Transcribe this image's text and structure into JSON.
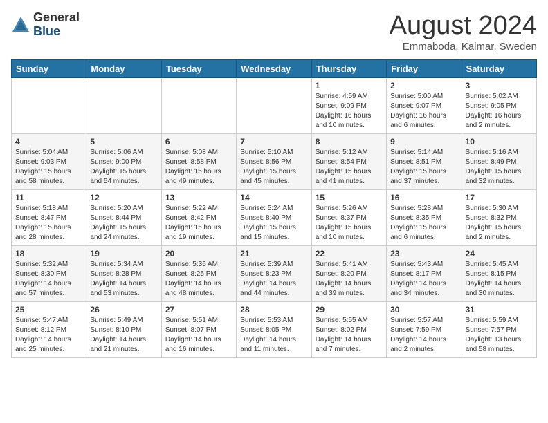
{
  "header": {
    "logo_general": "General",
    "logo_blue": "Blue",
    "month_title": "August 2024",
    "location": "Emmaboda, Kalmar, Sweden"
  },
  "days_of_week": [
    "Sunday",
    "Monday",
    "Tuesday",
    "Wednesday",
    "Thursday",
    "Friday",
    "Saturday"
  ],
  "weeks": [
    [
      {
        "day": "",
        "info": ""
      },
      {
        "day": "",
        "info": ""
      },
      {
        "day": "",
        "info": ""
      },
      {
        "day": "",
        "info": ""
      },
      {
        "day": "1",
        "info": "Sunrise: 4:59 AM\nSunset: 9:09 PM\nDaylight: 16 hours\nand 10 minutes."
      },
      {
        "day": "2",
        "info": "Sunrise: 5:00 AM\nSunset: 9:07 PM\nDaylight: 16 hours\nand 6 minutes."
      },
      {
        "day": "3",
        "info": "Sunrise: 5:02 AM\nSunset: 9:05 PM\nDaylight: 16 hours\nand 2 minutes."
      }
    ],
    [
      {
        "day": "4",
        "info": "Sunrise: 5:04 AM\nSunset: 9:03 PM\nDaylight: 15 hours\nand 58 minutes."
      },
      {
        "day": "5",
        "info": "Sunrise: 5:06 AM\nSunset: 9:00 PM\nDaylight: 15 hours\nand 54 minutes."
      },
      {
        "day": "6",
        "info": "Sunrise: 5:08 AM\nSunset: 8:58 PM\nDaylight: 15 hours\nand 49 minutes."
      },
      {
        "day": "7",
        "info": "Sunrise: 5:10 AM\nSunset: 8:56 PM\nDaylight: 15 hours\nand 45 minutes."
      },
      {
        "day": "8",
        "info": "Sunrise: 5:12 AM\nSunset: 8:54 PM\nDaylight: 15 hours\nand 41 minutes."
      },
      {
        "day": "9",
        "info": "Sunrise: 5:14 AM\nSunset: 8:51 PM\nDaylight: 15 hours\nand 37 minutes."
      },
      {
        "day": "10",
        "info": "Sunrise: 5:16 AM\nSunset: 8:49 PM\nDaylight: 15 hours\nand 32 minutes."
      }
    ],
    [
      {
        "day": "11",
        "info": "Sunrise: 5:18 AM\nSunset: 8:47 PM\nDaylight: 15 hours\nand 28 minutes."
      },
      {
        "day": "12",
        "info": "Sunrise: 5:20 AM\nSunset: 8:44 PM\nDaylight: 15 hours\nand 24 minutes."
      },
      {
        "day": "13",
        "info": "Sunrise: 5:22 AM\nSunset: 8:42 PM\nDaylight: 15 hours\nand 19 minutes."
      },
      {
        "day": "14",
        "info": "Sunrise: 5:24 AM\nSunset: 8:40 PM\nDaylight: 15 hours\nand 15 minutes."
      },
      {
        "day": "15",
        "info": "Sunrise: 5:26 AM\nSunset: 8:37 PM\nDaylight: 15 hours\nand 10 minutes."
      },
      {
        "day": "16",
        "info": "Sunrise: 5:28 AM\nSunset: 8:35 PM\nDaylight: 15 hours\nand 6 minutes."
      },
      {
        "day": "17",
        "info": "Sunrise: 5:30 AM\nSunset: 8:32 PM\nDaylight: 15 hours\nand 2 minutes."
      }
    ],
    [
      {
        "day": "18",
        "info": "Sunrise: 5:32 AM\nSunset: 8:30 PM\nDaylight: 14 hours\nand 57 minutes."
      },
      {
        "day": "19",
        "info": "Sunrise: 5:34 AM\nSunset: 8:28 PM\nDaylight: 14 hours\nand 53 minutes."
      },
      {
        "day": "20",
        "info": "Sunrise: 5:36 AM\nSunset: 8:25 PM\nDaylight: 14 hours\nand 48 minutes."
      },
      {
        "day": "21",
        "info": "Sunrise: 5:39 AM\nSunset: 8:23 PM\nDaylight: 14 hours\nand 44 minutes."
      },
      {
        "day": "22",
        "info": "Sunrise: 5:41 AM\nSunset: 8:20 PM\nDaylight: 14 hours\nand 39 minutes."
      },
      {
        "day": "23",
        "info": "Sunrise: 5:43 AM\nSunset: 8:17 PM\nDaylight: 14 hours\nand 34 minutes."
      },
      {
        "day": "24",
        "info": "Sunrise: 5:45 AM\nSunset: 8:15 PM\nDaylight: 14 hours\nand 30 minutes."
      }
    ],
    [
      {
        "day": "25",
        "info": "Sunrise: 5:47 AM\nSunset: 8:12 PM\nDaylight: 14 hours\nand 25 minutes."
      },
      {
        "day": "26",
        "info": "Sunrise: 5:49 AM\nSunset: 8:10 PM\nDaylight: 14 hours\nand 21 minutes."
      },
      {
        "day": "27",
        "info": "Sunrise: 5:51 AM\nSunset: 8:07 PM\nDaylight: 14 hours\nand 16 minutes."
      },
      {
        "day": "28",
        "info": "Sunrise: 5:53 AM\nSunset: 8:05 PM\nDaylight: 14 hours\nand 11 minutes."
      },
      {
        "day": "29",
        "info": "Sunrise: 5:55 AM\nSunset: 8:02 PM\nDaylight: 14 hours\nand 7 minutes."
      },
      {
        "day": "30",
        "info": "Sunrise: 5:57 AM\nSunset: 7:59 PM\nDaylight: 14 hours\nand 2 minutes."
      },
      {
        "day": "31",
        "info": "Sunrise: 5:59 AM\nSunset: 7:57 PM\nDaylight: 13 hours\nand 58 minutes."
      }
    ]
  ]
}
